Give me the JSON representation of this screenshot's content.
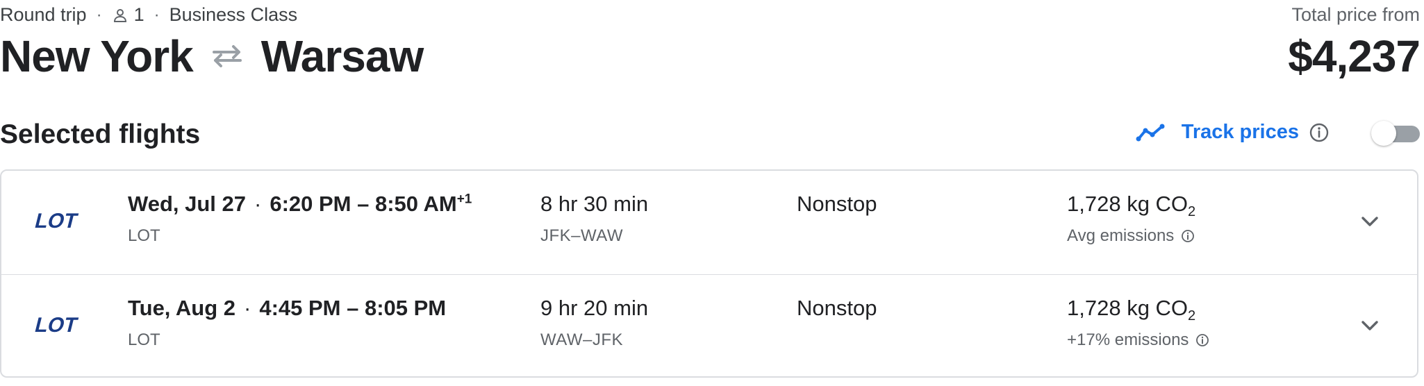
{
  "header": {
    "trip_type": "Round trip",
    "passengers": "1",
    "cabin_class": "Business Class",
    "origin": "New York",
    "destination": "Warsaw",
    "price_label": "Total price from",
    "price": "$4,237"
  },
  "section": {
    "title": "Selected flights",
    "track_prices_label": "Track prices",
    "track_prices_enabled": false
  },
  "flights": [
    {
      "date": "Wed, Jul 27",
      "depart": "6:20 PM",
      "arrive": "8:50 AM",
      "day_offset": "+1",
      "airline": "LOT",
      "logo_text": "LOT",
      "duration": "8 hr 30 min",
      "airports": "JFK–WAW",
      "stops": "Nonstop",
      "emissions_value": "1,728 kg CO",
      "emissions_sub": "2",
      "emissions_note": "Avg emissions"
    },
    {
      "date": "Tue, Aug 2",
      "depart": "4:45 PM",
      "arrive": "8:05 PM",
      "day_offset": "",
      "airline": "LOT",
      "logo_text": "LOT",
      "duration": "9 hr 20 min",
      "airports": "WAW–JFK",
      "stops": "Nonstop",
      "emissions_value": "1,728 kg CO",
      "emissions_sub": "2",
      "emissions_note": "+17% emissions"
    }
  ],
  "icons": {
    "person": "person-icon",
    "swap": "swap-arrows-icon",
    "trend": "trend-line-icon",
    "info": "info-icon",
    "expand": "chevron-down-icon"
  },
  "colors": {
    "accent": "#1a73e8",
    "text_primary": "#202124",
    "text_secondary": "#5f6368",
    "border": "#dadce0",
    "lot_logo": "#1b3c87"
  }
}
